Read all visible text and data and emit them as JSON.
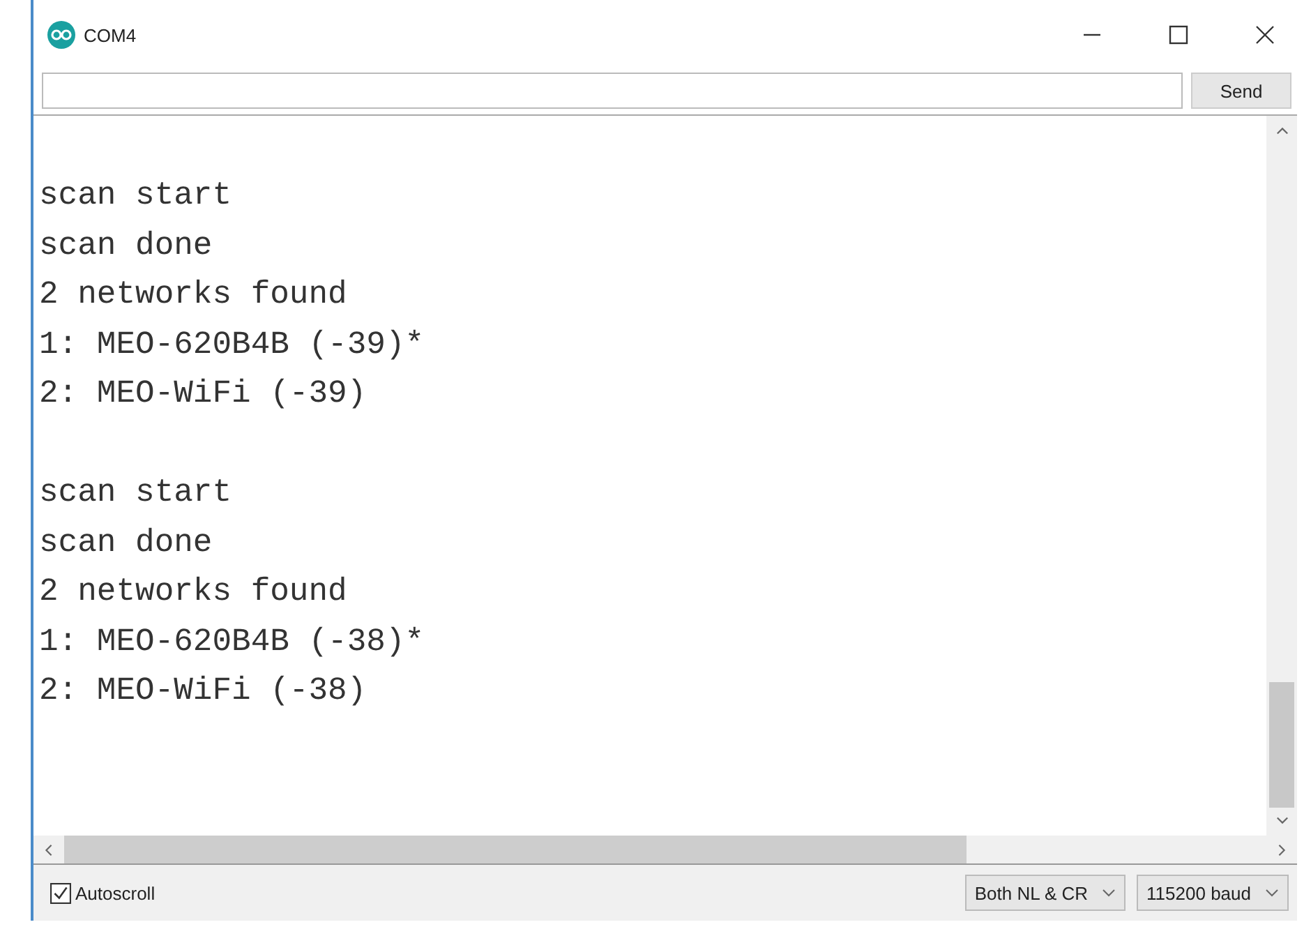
{
  "window": {
    "title": "COM4"
  },
  "send_button": "Send",
  "output": {
    "blocks": [
      [
        "scan start",
        "scan done",
        "2 networks found",
        "1: MEO-620B4B (-39)*",
        "2: MEO-WiFi (-39)"
      ],
      [
        "scan start",
        "scan done",
        "2 networks found",
        "1: MEO-620B4B (-38)*",
        "2: MEO-WiFi (-38)"
      ]
    ]
  },
  "autoscroll": {
    "label": "Autoscroll",
    "checked": true
  },
  "line_ending": "Both NL & CR",
  "baud": "115200 baud"
}
